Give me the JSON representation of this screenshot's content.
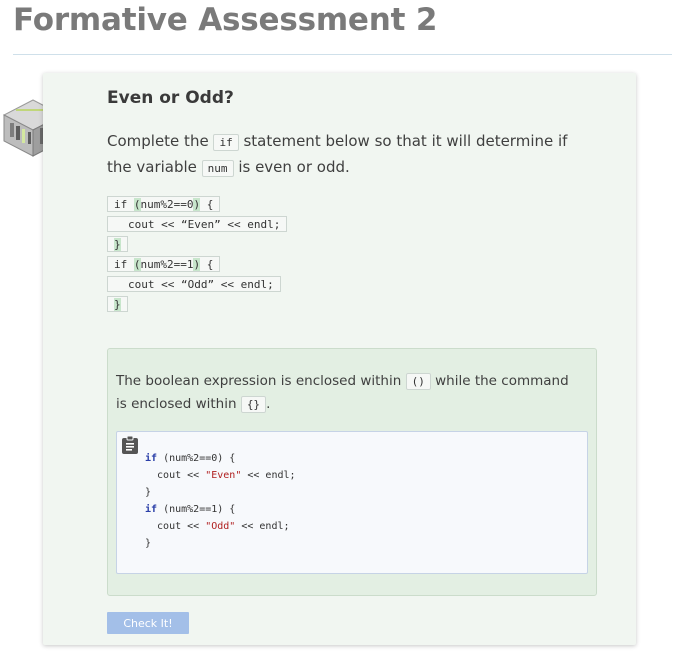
{
  "page": {
    "title": "Formative Assessment 2"
  },
  "card": {
    "title": "Even or Odd?",
    "prompt": {
      "part1": "Complete the ",
      "code1": "if",
      "part2": " statement below so that it will determine if the variable ",
      "code2": "num",
      "part3": " is even or odd."
    },
    "blocks": [
      {
        "pre": "if ",
        "gap_text": "(",
        "mid": "num%2==0",
        "gap2_text": ")",
        "post": " {"
      },
      {
        "body": "cout << “Even” << endl;"
      },
      {
        "brace": "}"
      },
      {
        "pre": "if ",
        "gap_text": "(",
        "mid": "num%2==1",
        "gap2_text": ")",
        "post": " {"
      },
      {
        "body": "cout << “Odd” << endl;"
      },
      {
        "brace": "}"
      }
    ],
    "hint": {
      "part1": "The boolean expression is enclosed within ",
      "code1": "()",
      "part2": " while the command is enclosed within ",
      "code2": "{}",
      "part3": ".",
      "code_lines": [
        {
          "kw": "if",
          "rest": " (num%2==0) {"
        },
        {
          "plain": "  cout << ",
          "str": "\"Even\"",
          "tail": " << endl;"
        },
        {
          "plain": "}"
        },
        {
          "kw": "if",
          "rest": " (num%2==1) {"
        },
        {
          "plain": "  cout << ",
          "str": "\"Odd\"",
          "tail": " << endl;"
        },
        {
          "plain": "}"
        }
      ]
    },
    "check_label": "Check It!"
  },
  "icons": {
    "cube": "cube-illustration-icon",
    "clipboard": "clipboard-icon"
  }
}
